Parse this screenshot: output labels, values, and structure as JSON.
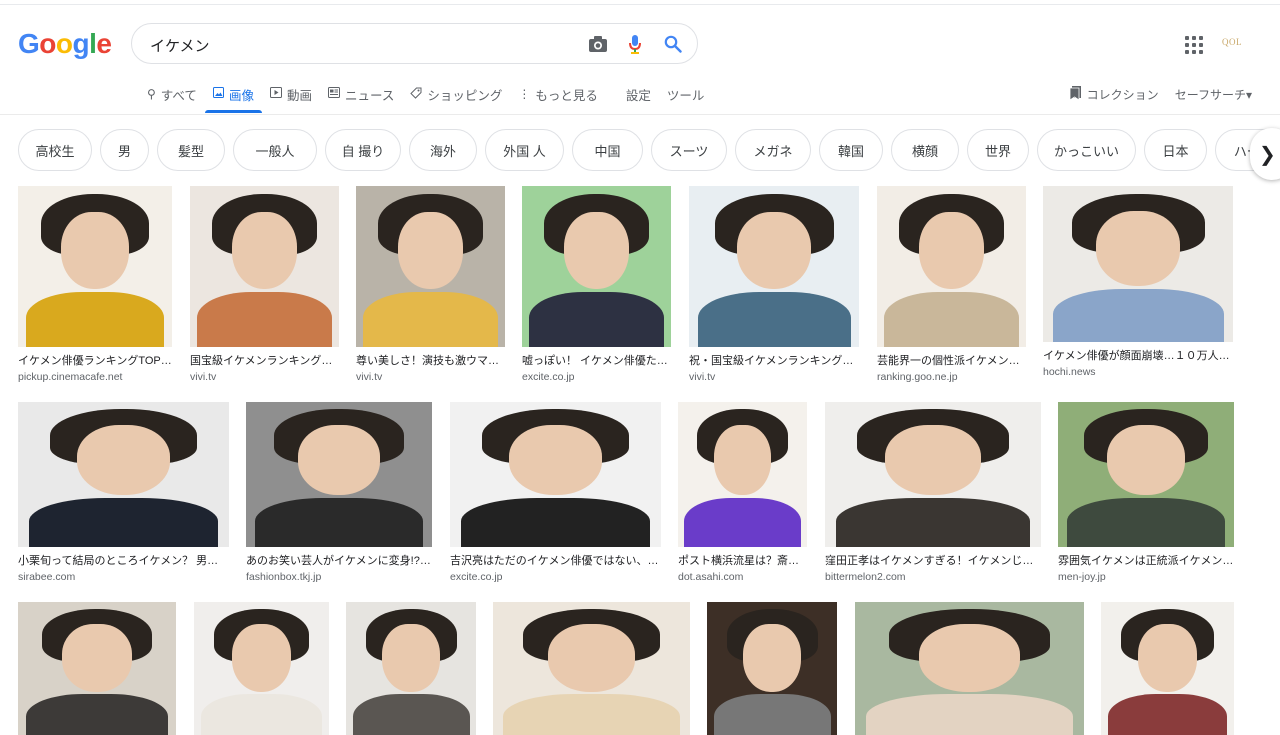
{
  "search": {
    "query": "イケメン"
  },
  "logo": [
    "G",
    "o",
    "o",
    "g",
    "l",
    "e"
  ],
  "logo_colors": [
    "#4285f4",
    "#ea4335",
    "#fbbc05",
    "#4285f4",
    "#34a853",
    "#ea4335"
  ],
  "account": {
    "label": "QOL"
  },
  "tabs": [
    {
      "label": "すべて",
      "icon": "search-icon"
    },
    {
      "label": "画像",
      "icon": "image-icon",
      "active": true
    },
    {
      "label": "動画",
      "icon": "video-icon"
    },
    {
      "label": "ニュース",
      "icon": "news-icon"
    },
    {
      "label": "ショッピング",
      "icon": "tag-icon"
    },
    {
      "label": "もっと見る",
      "icon": "more-vert-icon"
    }
  ],
  "tools": {
    "settings": "設定",
    "tools": "ツール"
  },
  "right_tools": {
    "collection": "コレクション",
    "safesearch": "セーフサーチ▾"
  },
  "chips": [
    "高校生",
    "男",
    "髪型",
    "一般人",
    "自 撮り",
    "海外",
    "外国 人",
    "中国",
    "スーツ",
    "メガネ",
    "韓国",
    "横顔",
    "世界",
    "かっこいい",
    "日本",
    "ハーフ"
  ],
  "results": [
    {
      "caption": "イケメン俳優ランキングTOP…",
      "domain": "pickup.cinemacafe.net"
    },
    {
      "caption": "国宝級イケメンランキング…",
      "domain": "vivi.tv"
    },
    {
      "caption": "尊い美しさ！演技も激ウマ…",
      "domain": "vivi.tv"
    },
    {
      "caption": "嘘っぽい！ イケメン俳優た…",
      "domain": "excite.co.jp"
    },
    {
      "caption": "祝・国宝級イケメンランキング…",
      "domain": "vivi.tv"
    },
    {
      "caption": "芸能界一の個性派イケメン…",
      "domain": "ranking.goo.ne.jp"
    },
    {
      "caption": "イケメン俳優が顔面崩壊…１０万人に１人…",
      "domain": "hochi.news"
    },
    {
      "caption": "小栗旬って結局のところイケメン？ 男…",
      "domain": "sirabee.com"
    },
    {
      "caption": "あのお笑い芸人がイケメンに変身!?…",
      "domain": "fashionbox.tkj.jp"
    },
    {
      "caption": "吉沢亮はただのイケメン俳優ではない、…",
      "domain": "excite.co.jp"
    },
    {
      "caption": "ポスト横浜流星は？斎…",
      "domain": "dot.asahi.com"
    },
    {
      "caption": "窪田正孝はイケメンすぎる！イケメンじ…",
      "domain": "bittermelon2.com"
    },
    {
      "caption": "雰囲気イケメンは正統派イケメンより…",
      "domain": "men-joy.jp"
    },
    {
      "caption": "",
      "domain": ""
    },
    {
      "caption": "",
      "domain": ""
    },
    {
      "caption": "",
      "domain": ""
    },
    {
      "caption": "",
      "domain": ""
    },
    {
      "caption": "",
      "domain": ""
    },
    {
      "caption": "",
      "domain": ""
    },
    {
      "caption": "",
      "domain": ""
    }
  ],
  "colors": {
    "accent": "#1a73e8",
    "chip_border": "#dfe1e5"
  }
}
